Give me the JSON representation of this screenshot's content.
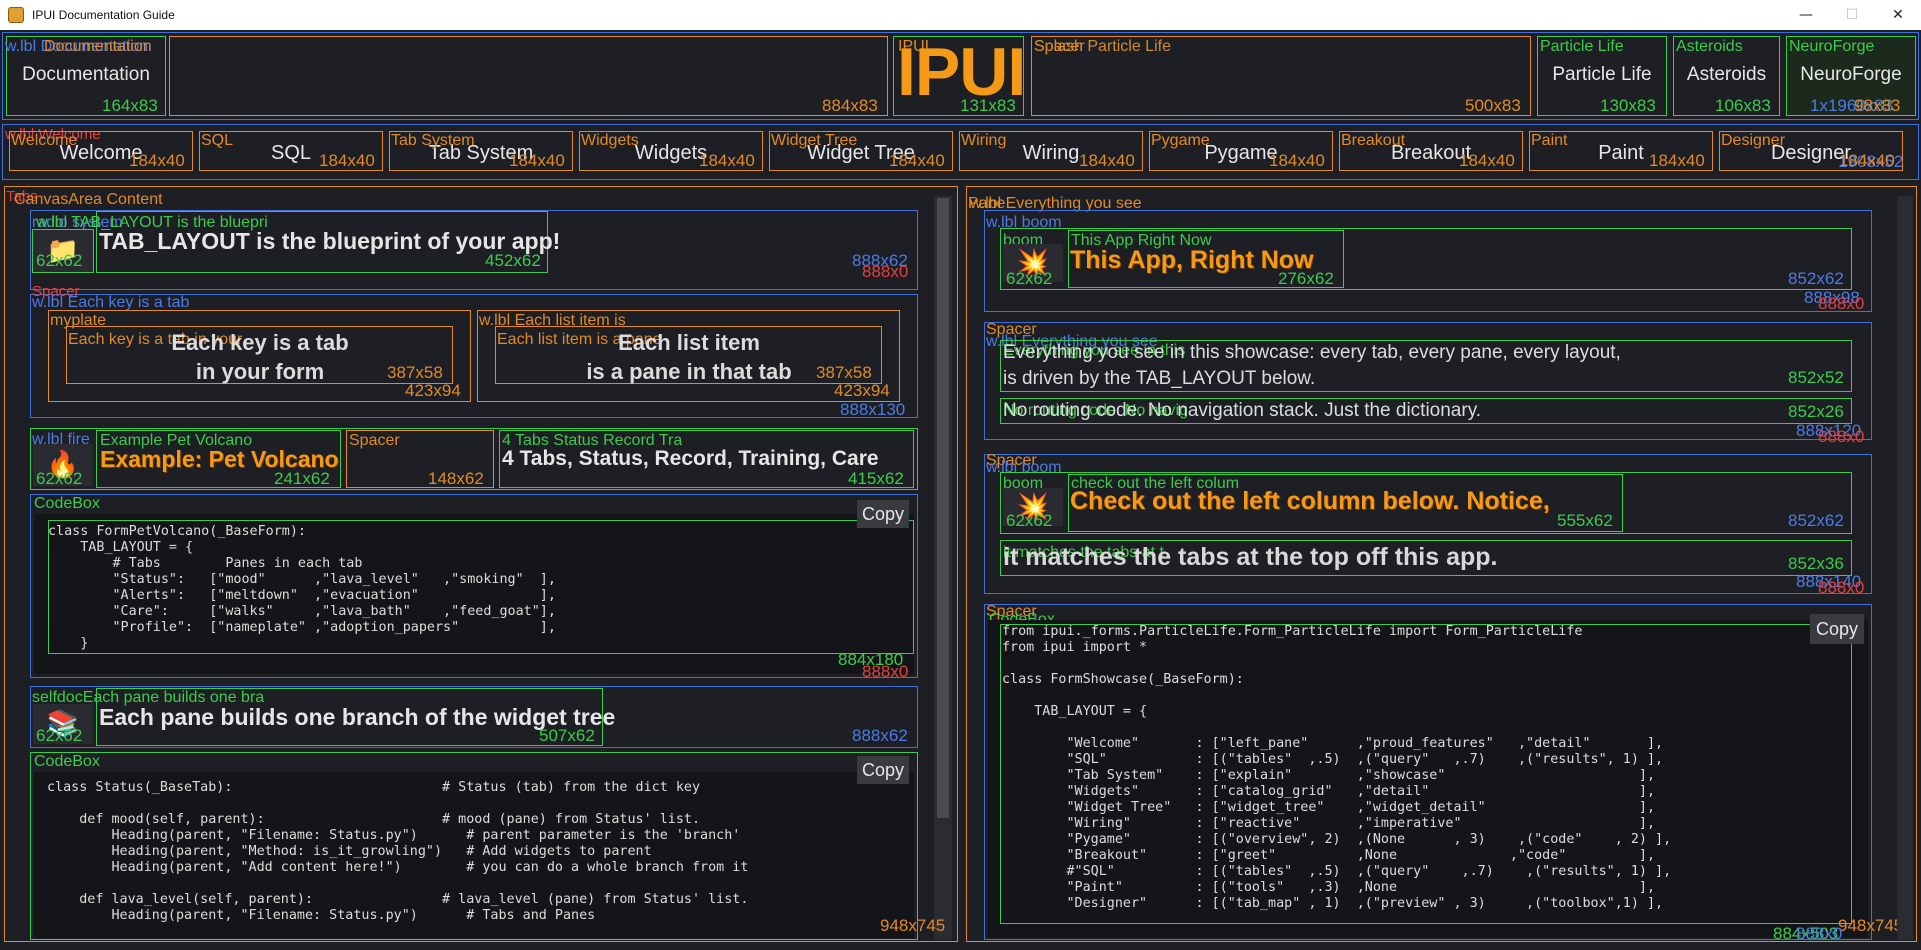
{
  "window": {
    "title": "IPUI Documentation Guide",
    "buttons": {
      "minimize": "—",
      "maximize": "☐",
      "close": "✕"
    }
  },
  "header": {
    "tags": {
      "doc_overlap_a": "w.lbl Documentation",
      "doc_overlap_b": "Documentation",
      "ipui": "IPUI",
      "spacer": "Spacer",
      "splash_particle": "Splash Particle Life",
      "particle_life": "Particle Life",
      "asteroids": "Asteroids",
      "neuroforge": "NeuroForge"
    },
    "logo": "IPUI",
    "buttons": {
      "documentation": "Documentation",
      "particle_life": "Particle Life",
      "asteroids": "Asteroids",
      "neuroforge": "NeuroForge"
    },
    "sizes": {
      "documentation": "164x83",
      "spacer_left": "884x83",
      "ipui": "131x83",
      "spacer_right": "500x83",
      "particle_life": "130x83",
      "asteroids": "106x83",
      "neuroforge_a": "98x83",
      "neuroforge_b": "1x1960x83"
    }
  },
  "tabs": {
    "row_tag_a": "w.lbl Welcome",
    "items": [
      {
        "tag": "Welcome",
        "label": "Welcome",
        "size": "184x40"
      },
      {
        "tag": "SQL",
        "label": "SQL",
        "size": "184x40"
      },
      {
        "tag": "Tab System",
        "label": "Tab System",
        "size": "184x40"
      },
      {
        "tag": "Widgets",
        "label": "Widgets",
        "size": "184x40"
      },
      {
        "tag": "Widget Tree",
        "label": "Widget Tree",
        "size": "184x40"
      },
      {
        "tag": "Wiring",
        "label": "Wiring",
        "size": "184x40"
      },
      {
        "tag": "Pygame",
        "label": "Pygame",
        "size": "184x40"
      },
      {
        "tag": "Breakout",
        "label": "Breakout",
        "size": "184x40"
      },
      {
        "tag": "Paint",
        "label": "Paint",
        "size": "184x40"
      },
      {
        "tag": "Designer",
        "label": "Designer",
        "size": "184x40"
      }
    ],
    "row_size": "1908x52"
  },
  "left_pane": {
    "tags": {
      "area_a": "Tabs",
      "area_b": "CanvasArea Content",
      "label_row": "w.lbl TAB_LAYOUT is the bluepri",
      "label_row_2": "radio system",
      "spacer_1": "Spacer",
      "each_key_lbl": "w.lbl Each key is a tab",
      "myplate": "myplate",
      "each_key_inner": "Each key is a tab in your",
      "each_item_lbl": "w.lbl Each list item is",
      "each_item_inner": "Each list item is a pane",
      "fire_lbl": "w.lbl fire",
      "example_lbl": "Example Pet Volcano",
      "spacer_2": "Spacer",
      "tabs_status_lbl": "4 Tabs Status Record Tra",
      "codebox_1": "CodeBox",
      "tree_lbl": "selfdocEach pane builds one bra",
      "codebox_2": "CodeBox"
    },
    "blueprint": {
      "icon": "📁",
      "heading": "TAB_LAYOUT is the blueprint of your app!",
      "icon_size": "62x62",
      "heading_size": "452x62",
      "row_size_a": "888x62",
      "row_size_b": "888x0"
    },
    "cards": {
      "key_line1": "Each key is a tab",
      "key_line2": "in your form",
      "key_inner_size": "387x58",
      "key_outer_size": "423x94",
      "item_line1": "Each list item",
      "item_line2": "is a pane in that tab",
      "item_inner_size": "387x58",
      "item_outer_size": "423x94",
      "row_size": "888x130"
    },
    "example": {
      "icon": "🔥",
      "heading": "Example: Pet Volcano",
      "tabs_text": "4 Tabs, Status, Record, Training, Care",
      "icon_size": "62x62",
      "heading_size": "241x62",
      "spacer_size": "148x62",
      "tabs_size": "415x62"
    },
    "code1": {
      "copy": "Copy",
      "lines": [
        "class FormPetVolcano(_BaseForm):",
        "    TAB_LAYOUT = {",
        "        # Tabs        Panes in each tab",
        "        \"Status\":   [\"mood\"      ,\"lava_level\"   ,\"smoking\"  ],",
        "        \"Alerts\":   [\"meltdown\"  ,\"evacuation\"               ],",
        "        \"Care\":     [\"walks\"     ,\"lava_bath\"    ,\"feed_goat\"],",
        "        \"Profile\":  [\"nameplate\" ,\"adoption_papers\"          ],",
        "    }"
      ],
      "size_a": "884x180",
      "size_b": "888x0"
    },
    "tree": {
      "icon": "📚",
      "heading": "Each pane builds one branch of the widget tree",
      "icon_size": "62x62",
      "heading_size": "507x62",
      "row_size": "888x62"
    },
    "code2": {
      "copy": "Copy",
      "lines": [
        "class Status(_BaseTab):                          # Status (tab) from the dict key",
        "",
        "    def mood(self, parent):                      # mood (pane) from Status' list.",
        "        Heading(parent, \"Filename: Status.py\")      # parent parameter is the 'branch'",
        "        Heading(parent, \"Method: is_it_growling\")   # Add widgets to parent",
        "        Heading(parent, \"Add content here!\")        # you can do a whole branch from it",
        "",
        "    def lava_level(self, parent):                # lava_level (pane) from Status' list.",
        "        Heading(parent, \"Filename: Status.py\")      # Tabs and Panes"
      ],
      "size": "948x745"
    }
  },
  "right_pane": {
    "tags": {
      "area": "Pane",
      "everything_lbl": "w.lbl Everything you see",
      "boom_lbl": "w.lbl boom",
      "boom_inner": "boom",
      "app_now_lbl": "This App Right Now",
      "spacer_1": "Spacer",
      "everything_lbl_2": "w.lbl Everything you see",
      "everything_inner": "Everything you see in this",
      "no_routing_inner": "No routing code. No navig",
      "spacer_2": "Spacer",
      "boom_lbl_2": "w.lbl boom",
      "boom_inner_2": "boom",
      "check_lbl": "check out the left colum",
      "matches_lbl": "it matches the tabs at t",
      "spacer_3": "Spacer",
      "codebox": "CodeBox"
    },
    "app_now": {
      "icon": "💥",
      "heading": "This App, Right Now",
      "icon_size": "62x62",
      "heading_size": "276x62",
      "row_size": "852x62",
      "outer_a": "888x98",
      "outer_b": "888x0"
    },
    "everything": {
      "line1": "Everything you see in this showcase: every tab, every pane, every layout,",
      "line2": "is driven by the TAB_LAYOUT below.",
      "line3": "No routing code. No navigation stack. Just the dictionary.",
      "size_1": "852x52",
      "size_2": "852x26",
      "outer_a": "888x120",
      "outer_b": "888x0"
    },
    "check": {
      "icon": "💥",
      "heading": "Check out the left column below.  Notice,",
      "sub": "it matches the tabs at the top off this app.",
      "icon_size": "62x62",
      "heading_size": "555x62",
      "row_size": "852x62",
      "sub_size": "852x36",
      "outer_a": "888x140",
      "outer_b": "888x0"
    },
    "code": {
      "copy": "Copy",
      "lines": [
        "from ipui._forms.ParticleLife.Form_ParticleLife import Form_ParticleLife",
        "from ipui import *",
        "",
        "class FormShowcase(_BaseForm):",
        "",
        "    TAB_LAYOUT = {",
        "",
        "        \"Welcome\"       : [\"left_pane\"      ,\"proud_features\"   ,\"detail\"       ],",
        "        \"SQL\"           : [(\"tables\"  ,.5)  ,(\"query\"   ,.7)    ,(\"results\", 1) ],",
        "        \"Tab System\"    : [\"explain\"        ,\"showcase\"                        ],",
        "        \"Widgets\"       : [\"catalog_grid\"   ,\"detail\"                          ],",
        "        \"Widget Tree\"   : [\"widget_tree\"    ,\"widget_detail\"                   ],",
        "        \"Wiring\"        : [\"reactive\"       ,\"imperative\"                      ],",
        "        \"Pygame\"        : [(\"overview\", 2)  ,(None      , 3)    ,(\"code\"    , 2) ],",
        "        \"Breakout\"      : [\"greet\"          ,None              ,\"code\"         ],",
        "        #\"SQL\"          : [(\"tables\"  ,.5)  ,(\"query\"    ,.7)    ,(\"results\", 1) ],",
        "        \"Paint\"         : [(\"tools\"   ,.3)  ,None                              ],",
        "        \"Designer\"      : [(\"tab_map\" , 1)  ,(\"preview\" , 3)     ,(\"toolbox\",1) ],"
      ],
      "size_a": "948x745",
      "size_b": "884x503",
      "size_c": "888x0"
    }
  }
}
